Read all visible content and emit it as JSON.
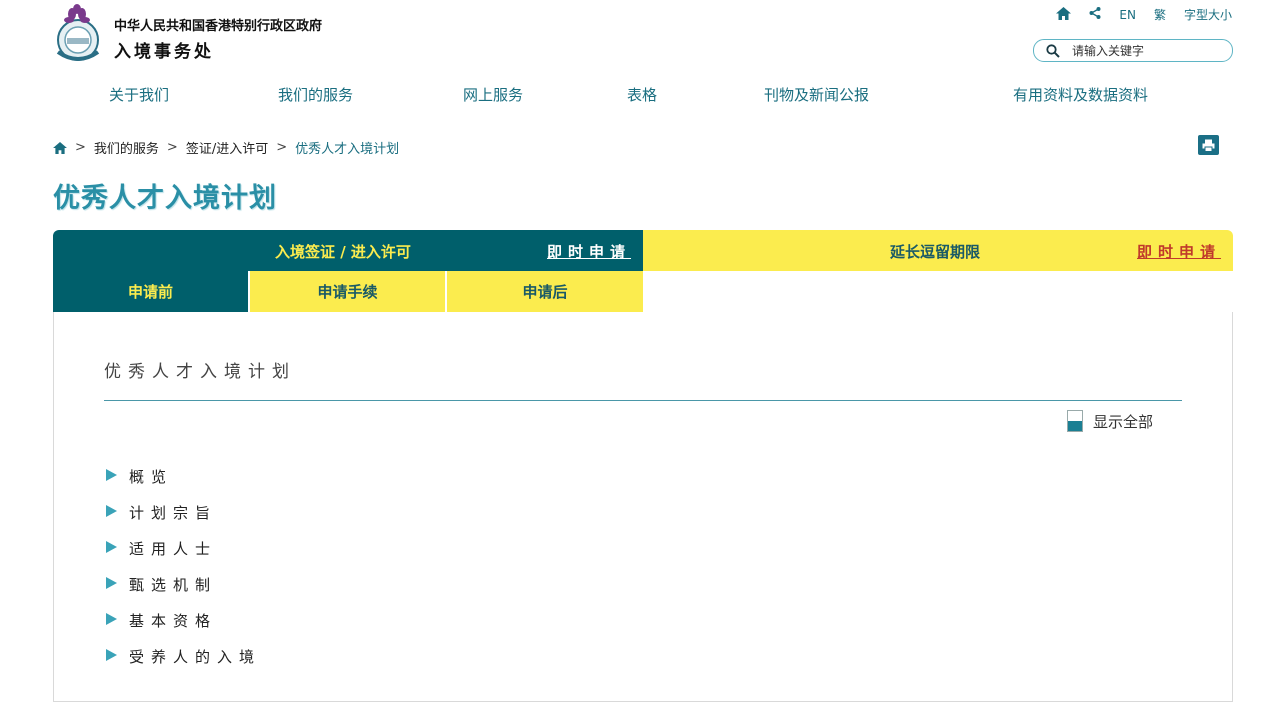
{
  "header": {
    "gov_name": "中华人民共和国香港特别行政区政府",
    "dept_name": "入境事务处",
    "top_links": {
      "lang_en": "EN",
      "lang_trad": "繁",
      "font_size": "字型大小"
    },
    "search_placeholder": "请输入关键字"
  },
  "nav": [
    "关于我们",
    "我们的服务",
    "网上服务",
    "表格",
    "刊物及新闻公报",
    "有用资料及数据资料"
  ],
  "breadcrumb": [
    "我们的服务",
    "签证/进入许可",
    "优秀人才入境计划"
  ],
  "page_title": "优秀人才入境计划",
  "tabs": {
    "visa": {
      "label": "入境签证 / 进入许可",
      "apply": "即时申请"
    },
    "extension": {
      "label": "延长逗留期限",
      "apply": "即时申请"
    },
    "sub": [
      "申请前",
      "申请手续",
      "申请后"
    ]
  },
  "content": {
    "section_title": "优秀人才入境计划",
    "show_all": "显示全部",
    "items": [
      "概览",
      "计划宗旨",
      "适用人士",
      "甄选机制",
      "基本资格",
      "受养人的入境"
    ]
  },
  "colors": {
    "teal_dark": "#005f6b",
    "yellow": "#fbec4e",
    "accent": "#2a8fa6"
  }
}
